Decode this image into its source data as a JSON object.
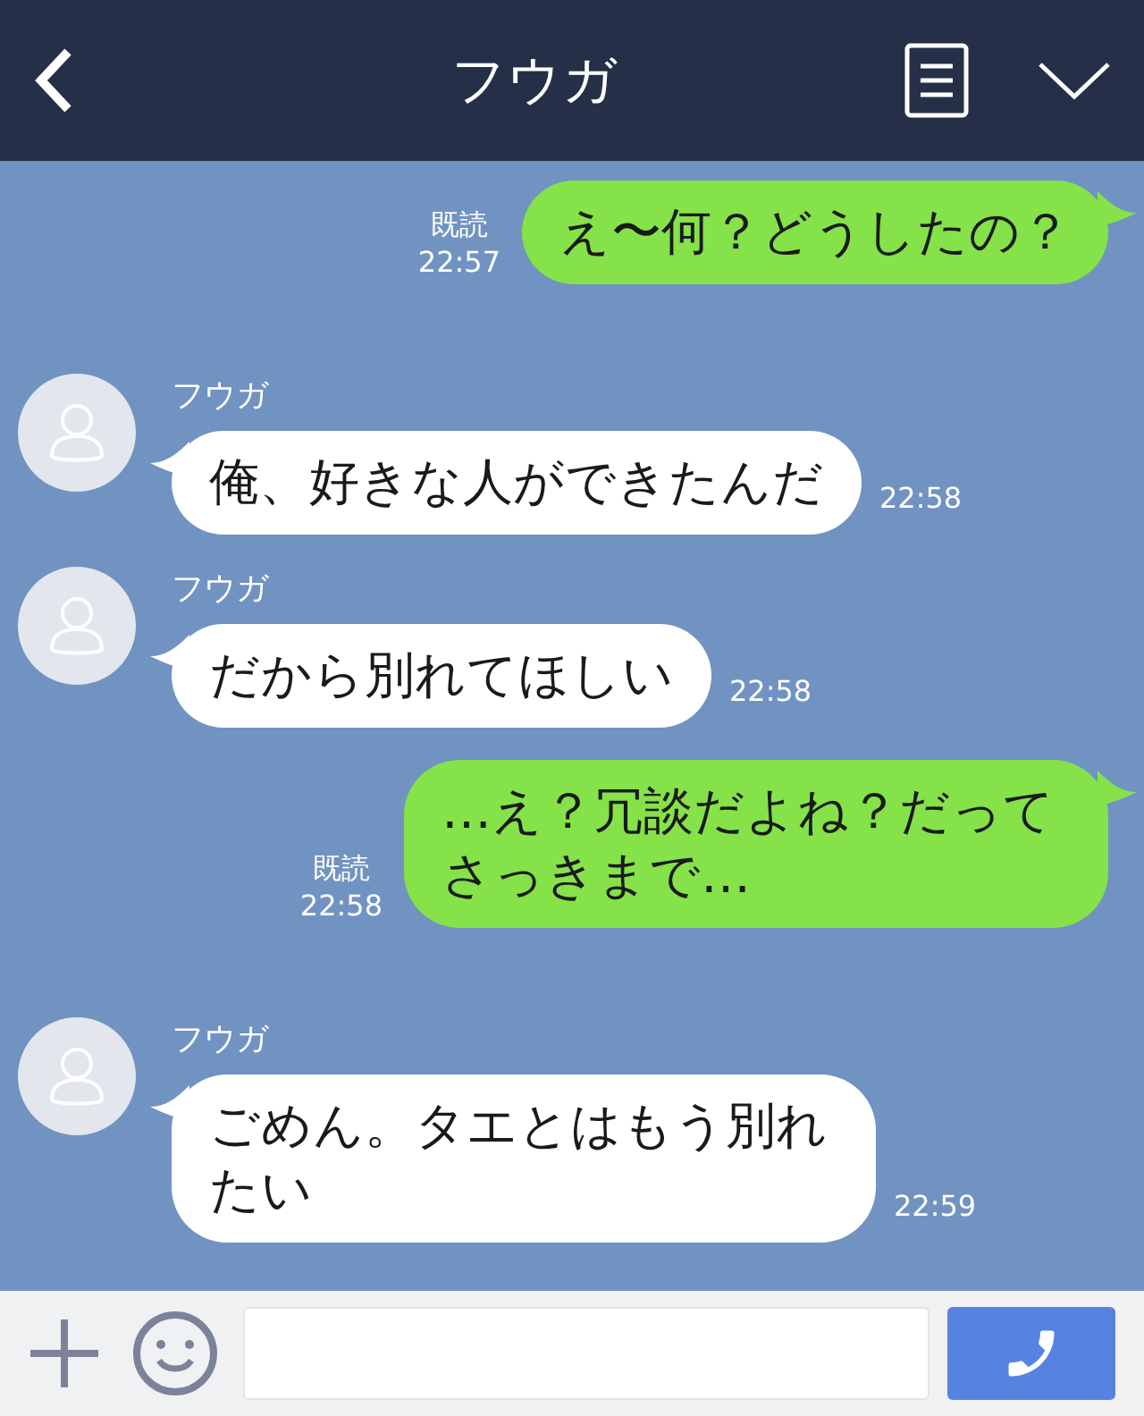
{
  "header": {
    "title": "フウガ"
  },
  "messages": [
    {
      "kind": "sent",
      "text": "え〜何？どうしたの？",
      "read": "既読",
      "time": "22:57"
    },
    {
      "kind": "received",
      "sender": "フウガ",
      "text": "俺、好きな人ができたんだ",
      "time": "22:58"
    },
    {
      "kind": "received",
      "sender": "フウガ",
      "text": "だから別れてほしい",
      "time": "22:58"
    },
    {
      "kind": "sent",
      "text": "…え？冗談だよね？だってさっきまで…",
      "read": "既読",
      "time": "22:58"
    },
    {
      "kind": "received",
      "sender": "フウガ",
      "text": "ごめん。タエとはもう別れたい",
      "time": "22:59"
    }
  ]
}
